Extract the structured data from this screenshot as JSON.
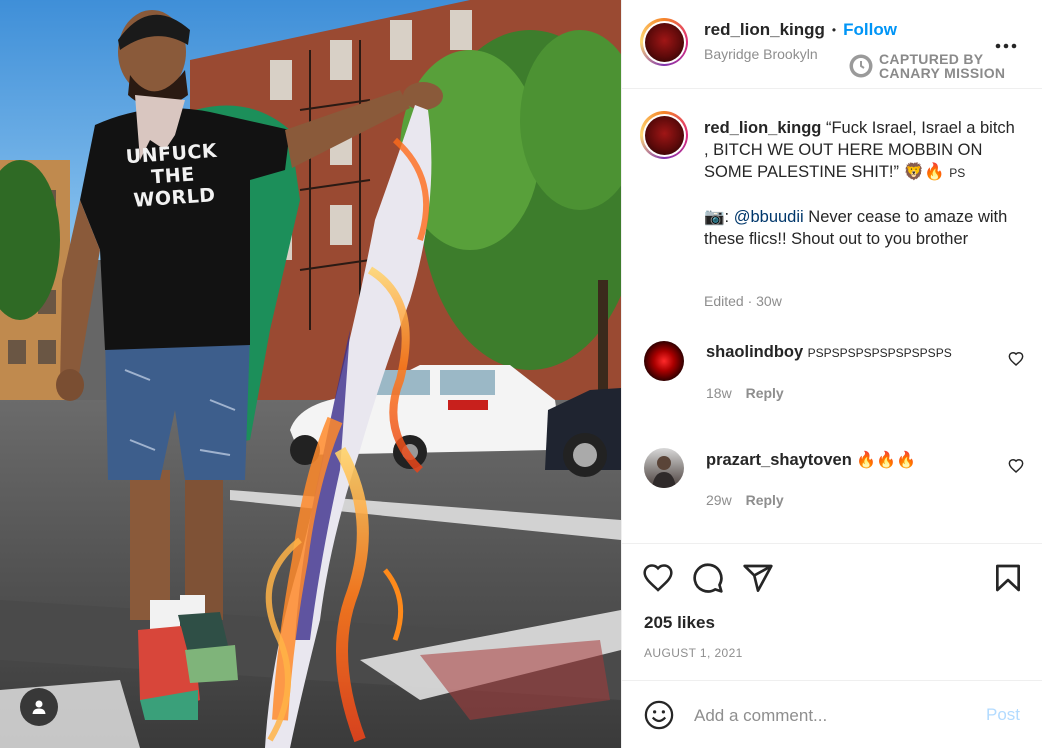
{
  "photo": {
    "shirt_text_line1": "UNFUCK",
    "shirt_text_line2": "THE",
    "shirt_text_line3": "WORLD",
    "user_tag_icon": "person-icon"
  },
  "header": {
    "username": "red_lion_kingg",
    "separator": "•",
    "follow_label": "Follow",
    "location": "Bayridge Brookyln",
    "more_icon": "more-horizontal-icon",
    "watermark_line1": "CAPTURED BY",
    "watermark_line2": "CANARY MISSION"
  },
  "caption": {
    "username": "red_lion_kingg",
    "text_part1": "“Fuck Israel, Israel a bitch , BITCH WE OUT HERE MOBBIN ON SOME PALESTINE SHIT!”",
    "emojis": "🦁🔥",
    "ps": "PS",
    "camera_emoji": "📷",
    "mention": "@bbuudii",
    "text_part2": "Never cease to amaze with these flics!! Shout out to you brother",
    "edited": "Edited · 30w"
  },
  "comments": [
    {
      "username": "shaolindboy",
      "text": "PSPSPSPSPSPSPSPSPS",
      "age": "18w",
      "reply_label": "Reply"
    },
    {
      "username": "prazart_shaytoven",
      "text": "🔥🔥🔥",
      "age": "29w",
      "reply_label": "Reply"
    }
  ],
  "actions": {
    "like_icon": "heart-icon",
    "comment_icon": "comment-icon",
    "share_icon": "send-icon",
    "save_icon": "bookmark-icon",
    "likes": "205 likes",
    "date": "AUGUST 1, 2021"
  },
  "add_comment": {
    "emoji_icon": "smiley-icon",
    "placeholder": "Add a comment...",
    "post_label": "Post"
  },
  "colors": {
    "link_blue": "#0095f6",
    "post_disabled": "#b3dbff",
    "secondary_text": "#8e8e8e",
    "divider": "#efefef"
  }
}
